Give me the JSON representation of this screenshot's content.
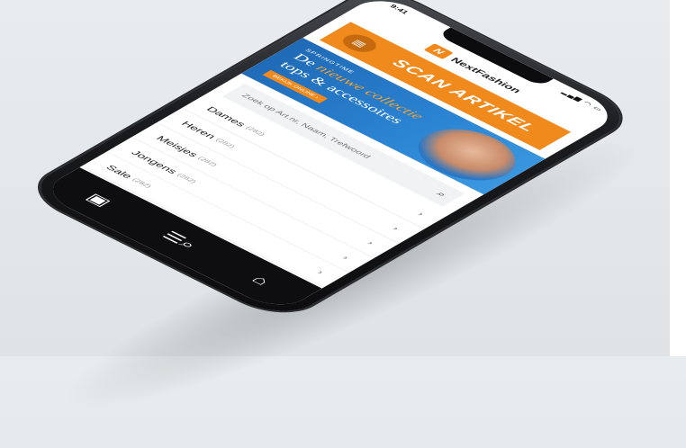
{
  "status": {
    "time": "9:41",
    "icons": "▂▄▆ ◠ ▭"
  },
  "brand": {
    "logo_mark": "N",
    "name": "NextFashion"
  },
  "scan_button": {
    "label": "SCAN ARTIKEL"
  },
  "banner": {
    "kicker": "SPRINGTIME",
    "title_prefix": "De ",
    "title_highlight": "nieuwe collectie",
    "title_line2": "tops & accessoires",
    "cta_label": "BEKIJK ONLINE  ›"
  },
  "search": {
    "placeholder": "Zoek op Art.nr, Naam, Trefwoord"
  },
  "categories": [
    {
      "name": "Dames",
      "count": "(282)"
    },
    {
      "name": "Heren",
      "count": "(282)"
    },
    {
      "name": "Meisjes",
      "count": "(282)"
    },
    {
      "name": "Jongens",
      "count": "(282)"
    },
    {
      "name": "Sale",
      "count": "(282)"
    }
  ],
  "tabbar": {
    "scan_icon": "▣",
    "menu_search_icon": "☰⌕",
    "bag_icon": "⌂"
  },
  "colors": {
    "accent": "#f08a1c",
    "banner_blue": "#1f69b6",
    "device": "#0c0c0e"
  }
}
